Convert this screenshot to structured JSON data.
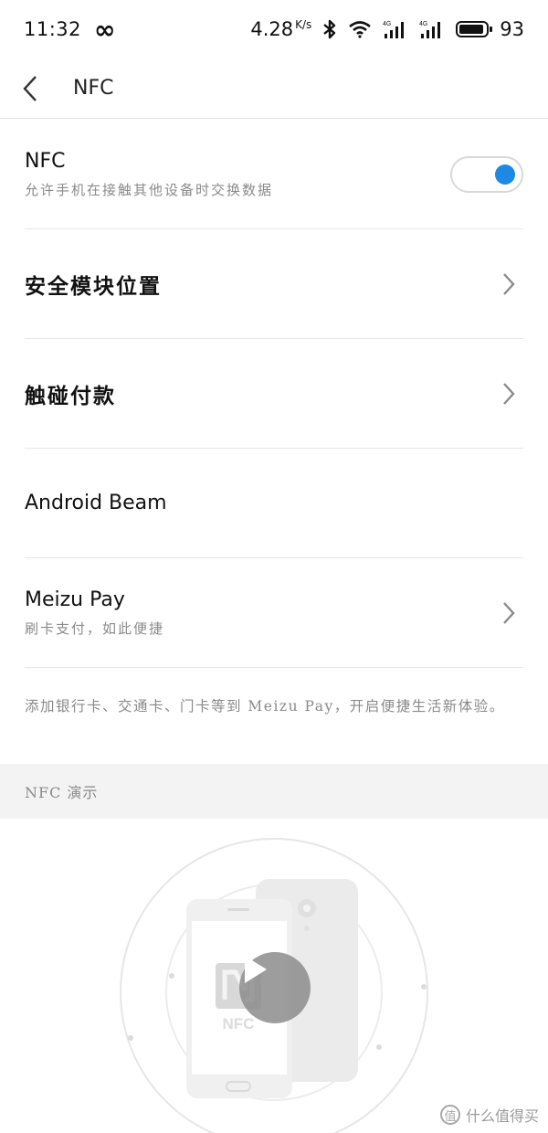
{
  "status_bar": {
    "time": "11:32",
    "loop_icon": "∞",
    "speed": "4.28",
    "speed_unit": "K/s",
    "battery_level": 93,
    "battery_text": "93",
    "network_label_1": "4G",
    "network_label_2": "4G"
  },
  "header": {
    "title": "NFC",
    "back_icon": "chevron-left-icon"
  },
  "settings": {
    "nfc": {
      "title": "NFC",
      "subtitle": "允许手机在接触其他设备时交换数据",
      "enabled": true
    },
    "secure_element": {
      "title": "安全模块位置"
    },
    "tap_to_pay": {
      "title": "触碰付款"
    },
    "android_beam": {
      "title": "Android Beam"
    },
    "meizu_pay": {
      "title": "Meizu Pay",
      "subtitle": "刷卡支付，如此便捷"
    }
  },
  "note": "添加银行卡、交通卡、门卡等到 Meizu Pay，开启便捷生活新体验。",
  "demo_section": {
    "title": "NFC 演示",
    "illustration_label": "NFC"
  },
  "watermark": {
    "badge": "值",
    "text": "什么值得买"
  },
  "colors": {
    "accent": "#1e88e5",
    "divider": "#e6e6e6",
    "secondary_text": "#8a8a8a"
  }
}
